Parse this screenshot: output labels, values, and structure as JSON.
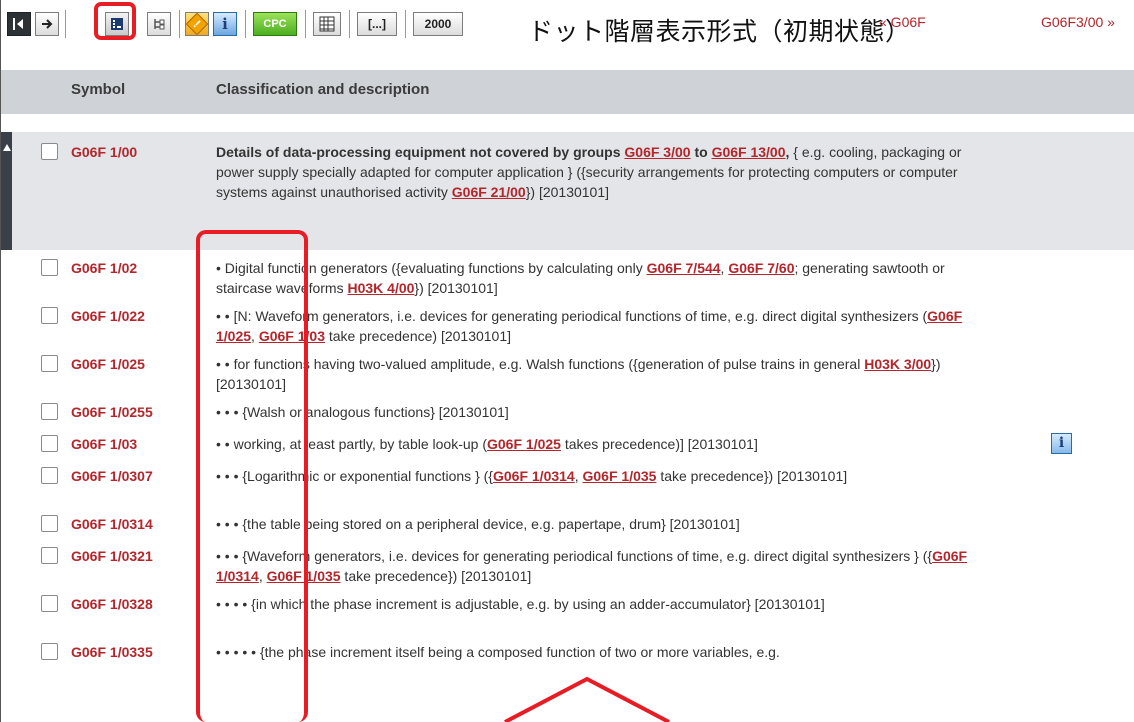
{
  "toolbar": {
    "caption": "ドット階層表示形式（初期状態）",
    "prev_link": "« G06F",
    "next_link": "G06F3/00 »",
    "cpc_label": "CPC",
    "year_label": "2000",
    "ellipsis_label": "[...]",
    "info_label": "i",
    "warn_label": "!"
  },
  "header": {
    "symbol_col": "Symbol",
    "desc_col": "Classification and description"
  },
  "rows": [
    {
      "symbol": "G06F 1/00",
      "parts": [
        {
          "t": "Details of data-processing equipment not covered by groups ",
          "b": true
        },
        {
          "t": "G06F 3/00",
          "r": true
        },
        {
          "t": " to ",
          "b": true
        },
        {
          "t": "G06F 13/00",
          "r": true
        },
        {
          "t": ", ",
          "b": true
        },
        {
          "t": "{ e.g. cooling, packaging or power supply specially adapted for computer application } ({security arrangements for protecting computers or computer systems against unauthorised activity "
        },
        {
          "t": "G06F 21/00",
          "r": true
        },
        {
          "t": "}) [20130101]"
        }
      ]
    },
    {
      "symbol": "G06F 1/02",
      "parts": [
        {
          "t": "• Digital function generators ({evaluating functions by calculating only "
        },
        {
          "t": "G06F 7/544",
          "r": true
        },
        {
          "t": ", "
        },
        {
          "t": "G06F 7/60",
          "r": true
        },
        {
          "t": "; generating sawtooth or staircase waveforms "
        },
        {
          "t": "H03K 4/00",
          "r": true
        },
        {
          "t": "}) [20130101]"
        }
      ]
    },
    {
      "symbol": "G06F 1/022",
      "parts": [
        {
          "t": "• • [N: Waveform generators, i.e. devices for generating periodical functions of time, e.g. direct digital synthesizers ("
        },
        {
          "t": "G06F 1/025",
          "r": true
        },
        {
          "t": ", "
        },
        {
          "t": "G06F 1/03",
          "r": true
        },
        {
          "t": " take precedence) [20130101]"
        }
      ]
    },
    {
      "symbol": "G06F 1/025",
      "parts": [
        {
          "t": "• • for functions having two-valued amplitude, e.g. Walsh functions ({generation of pulse trains in general "
        },
        {
          "t": "H03K 3/00",
          "r": true
        },
        {
          "t": "}) [20130101]"
        }
      ]
    },
    {
      "symbol": "G06F 1/0255",
      "parts": [
        {
          "t": "• • • {Walsh or analogous functions} [20130101]"
        }
      ]
    },
    {
      "symbol": "G06F 1/03",
      "info": true,
      "parts": [
        {
          "t": "• • working, at least partly, by table look-up ("
        },
        {
          "t": "G06F 1/025",
          "r": true
        },
        {
          "t": " takes precedence)] [20130101]"
        }
      ]
    },
    {
      "symbol": "G06F 1/0307",
      "parts": [
        {
          "t": "• • • {Logarithmic or exponential functions } ({"
        },
        {
          "t": "G06F 1/0314",
          "r": true
        },
        {
          "t": ", "
        },
        {
          "t": "G06F 1/035",
          "r": true
        },
        {
          "t": " take precedence}) [20130101]"
        }
      ]
    },
    {
      "symbol": "G06F 1/0314",
      "parts": [
        {
          "t": "• • • {the table being stored on a peripheral device, e.g. papertape, drum} [20130101]"
        }
      ]
    },
    {
      "symbol": "G06F 1/0321",
      "parts": [
        {
          "t": "• • • {Waveform generators, i.e. devices for generating periodical functions of time, e.g. direct digital synthesizers } ({"
        },
        {
          "t": "G06F 1/0314",
          "r": true
        },
        {
          "t": ", "
        },
        {
          "t": "G06F 1/035",
          "r": true
        },
        {
          "t": " take precedence}) [20130101]"
        }
      ]
    },
    {
      "symbol": "G06F 1/0328",
      "parts": [
        {
          "t": "• • • • {in which the phase increment is adjustable, e.g. by using an adder-accumulator} [20130101]"
        }
      ]
    },
    {
      "symbol": "G06F 1/0335",
      "parts": [
        {
          "t": "• • • • • {the phase increment itself being a composed function of two or more variables, e.g."
        }
      ]
    }
  ]
}
